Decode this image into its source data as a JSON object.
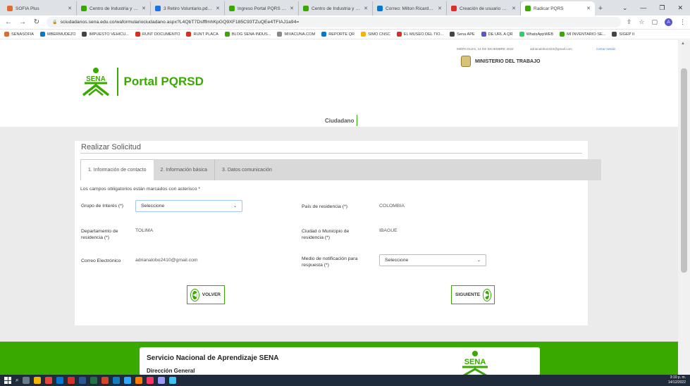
{
  "browser": {
    "tabs": [
      {
        "label": "SOFIA Plus",
        "color": "#e06b2e"
      },
      {
        "label": "Centro de Industria y Cons",
        "color": "#39a900"
      },
      {
        "label": "3 Retiro Voluntario.pdf - G",
        "color": "#1a73e8"
      },
      {
        "label": "Ingreso Portal PQRS Sena",
        "color": "#39a900"
      },
      {
        "label": "Centro de Industria y Cons",
        "color": "#39a900"
      },
      {
        "label": "Correo: Milton Ricardo Bar",
        "color": "#0078d4"
      },
      {
        "label": "Creación de usuario PQRS",
        "color": "#d93025"
      },
      {
        "label": "Radicar PQRS",
        "color": "#39a900",
        "active": true
      }
    ],
    "new_tab": "+",
    "url": "sciudadanos.sena.edu.co/waformulariociudadano.aspx?L4QbT7DsfffmhKpGQ9XF185C93TZuQEe4TFIAJ1a94=",
    "profile_initial": "A",
    "bookmarks": [
      {
        "label": "SENASOFIA",
        "color": "#e06b2e"
      },
      {
        "label": "MBERMUDEZO",
        "color": "#0078d4"
      },
      {
        "label": "IMPUESTO VEHICU...",
        "color": "#444"
      },
      {
        "label": "RUNT DOCUMENTO",
        "color": "#d93025"
      },
      {
        "label": "RUNT PLACA",
        "color": "#d93025"
      },
      {
        "label": "BLOG SENA INDUS...",
        "color": "#39a900"
      },
      {
        "label": "MIVACUNA.COM",
        "color": "#888"
      },
      {
        "label": "REPORTE QR",
        "color": "#0078d4"
      },
      {
        "label": "SIMO CNSC",
        "color": "#f4b400"
      },
      {
        "label": "EL MUSEO DEL TIO...",
        "color": "#d93025"
      },
      {
        "label": "Sena APE",
        "color": "#444"
      },
      {
        "label": "DE URL A QR",
        "color": "#5a57d4"
      },
      {
        "label": "WhatsAppWEB",
        "color": "#25d366"
      },
      {
        "label": "MI INVENTARIO SE...",
        "color": "#39a900"
      },
      {
        "label": "SIGEP II",
        "color": "#444"
      }
    ]
  },
  "header": {
    "date": "MIÉRCOLES, 14 DE DICIEMBRE 2022",
    "email": "adrianalobo2410@gmail.com",
    "logout": "Cerrar sesión",
    "ministry": "MINISTERIO DEL TRABAJO",
    "logo_text": "SENA",
    "portal_title": "Portal PQRSD",
    "nav_tab": "Ciudadano"
  },
  "form": {
    "title": "Realizar Solicitud",
    "tabs": [
      "1. Información de contacto",
      "2. Información básica",
      "3. Datos comunicación"
    ],
    "required_note": "Los campos obligatorios están marcados con asterisco *",
    "grupo_label": "Grupo de Interés (*)",
    "grupo_value": "Seleccione",
    "pais_label": "País de residencia (*)",
    "pais_value": "COLOMBIA",
    "depto_label": "Departamento de residencia (*)",
    "depto_value": "TOLIMA",
    "ciudad_label": "Ciudad o Municipio de residencia (*)",
    "ciudad_value": "IBAGUE",
    "correo_label": "Correo Electrónico",
    "correo_value": "adrianalobo2410@gmail.com",
    "medio_label": "Medio de notificación para respuesta (*)",
    "medio_value": "Seleccione",
    "back_button": "VOLVER",
    "next_button": "SIGUIENTE"
  },
  "footer": {
    "title": "Servicio Nacional de Aprendizaje SENA",
    "subtitle": "Dirección General",
    "logo_text": "SENA"
  },
  "taskbar": {
    "time": "3:10 p. m.",
    "date": "14/12/2022"
  },
  "colors": {
    "sena_green": "#39a900",
    "select_focus": "#9ec5f5"
  }
}
